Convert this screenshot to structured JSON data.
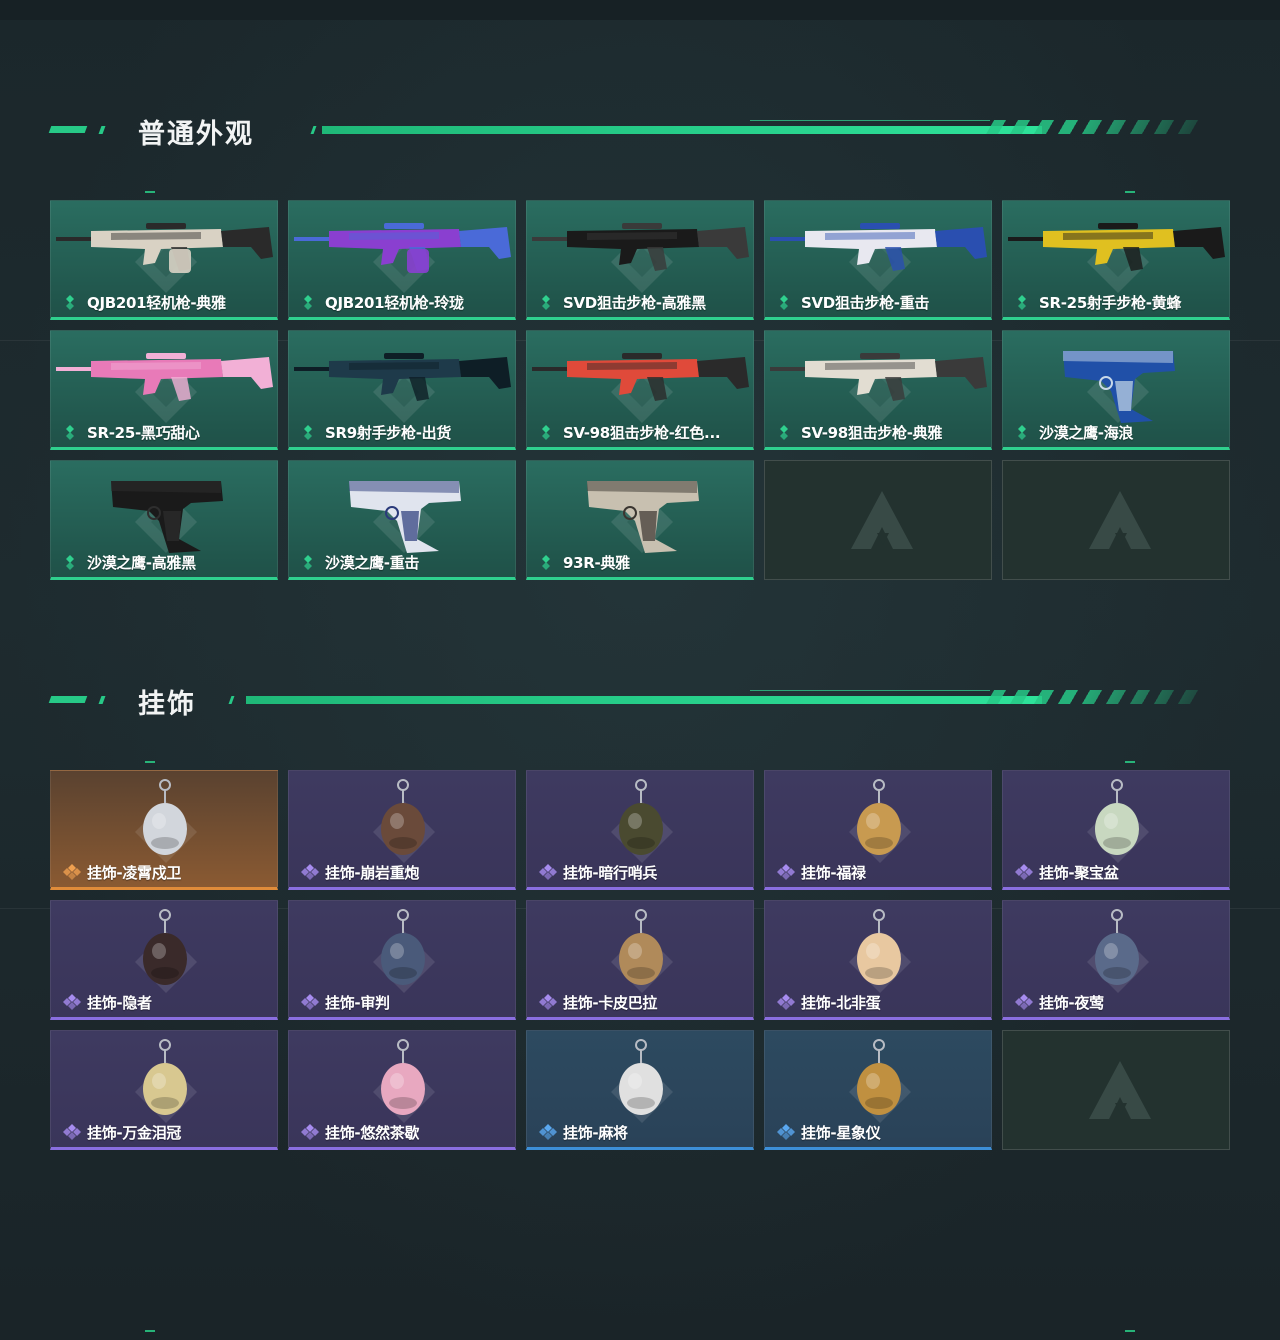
{
  "sections": [
    {
      "title": "普通外观",
      "items": [
        {
          "label": "QJB201轻机枪-典雅",
          "rarity": "green",
          "icon": "light-machine-gun"
        },
        {
          "label": "QJB201轻机枪-玲珑",
          "rarity": "green",
          "icon": "light-machine-gun"
        },
        {
          "label": "SVD狙击步枪-高雅黑",
          "rarity": "green",
          "icon": "sniper-rifle"
        },
        {
          "label": "SVD狙击步枪-重击",
          "rarity": "green",
          "icon": "sniper-rifle"
        },
        {
          "label": "SR-25射手步枪-黄蜂",
          "rarity": "green",
          "icon": "marksman-rifle"
        },
        {
          "label": "SR-25-黑巧甜心",
          "rarity": "green",
          "icon": "marksman-rifle"
        },
        {
          "label": "SR9射手步枪-出货",
          "rarity": "green",
          "icon": "marksman-rifle"
        },
        {
          "label": "SV-98狙击步枪-红色...",
          "rarity": "green",
          "icon": "sniper-rifle"
        },
        {
          "label": "SV-98狙击步枪-典雅",
          "rarity": "green",
          "icon": "sniper-rifle"
        },
        {
          "label": "沙漠之鹰-海浪",
          "rarity": "green",
          "icon": "pistol"
        },
        {
          "label": "沙漠之鹰-高雅黑",
          "rarity": "green",
          "icon": "pistol"
        },
        {
          "label": "沙漠之鹰-重击",
          "rarity": "green",
          "icon": "pistol"
        },
        {
          "label": "93R-典雅",
          "rarity": "green",
          "icon": "pistol"
        },
        {
          "label": "",
          "rarity": "empty",
          "icon": "logo"
        },
        {
          "label": "",
          "rarity": "empty",
          "icon": "logo"
        }
      ]
    },
    {
      "title": "挂饰",
      "items": [
        {
          "label": "挂饰-凌霄戍卫",
          "rarity": "orange",
          "icon": "charm"
        },
        {
          "label": "挂饰-崩岩重炮",
          "rarity": "purple",
          "icon": "charm"
        },
        {
          "label": "挂饰-暗行哨兵",
          "rarity": "purple",
          "icon": "charm"
        },
        {
          "label": "挂饰-福禄",
          "rarity": "purple",
          "icon": "charm"
        },
        {
          "label": "挂饰-聚宝盆",
          "rarity": "purple",
          "icon": "charm"
        },
        {
          "label": "挂饰-隐者",
          "rarity": "purple",
          "icon": "charm"
        },
        {
          "label": "挂饰-审判",
          "rarity": "purple",
          "icon": "charm"
        },
        {
          "label": "挂饰-卡皮巴拉",
          "rarity": "purple",
          "icon": "charm"
        },
        {
          "label": "挂饰-北非蛋",
          "rarity": "purple",
          "icon": "charm"
        },
        {
          "label": "挂饰-夜莺",
          "rarity": "purple",
          "icon": "charm"
        },
        {
          "label": "挂饰-万金泪冠",
          "rarity": "purple",
          "icon": "charm"
        },
        {
          "label": "挂饰-悠然茶歇",
          "rarity": "purple",
          "icon": "charm"
        },
        {
          "label": "挂饰-麻将",
          "rarity": "blue",
          "icon": "charm"
        },
        {
          "label": "挂饰-星象仪",
          "rarity": "blue",
          "icon": "charm"
        },
        {
          "label": "",
          "rarity": "empty",
          "icon": "logo"
        }
      ]
    }
  ],
  "colors": {
    "accent": "#27c987",
    "green_card": "#2a6d60",
    "purple_card": "#3e3a60",
    "orange_card": "#8a5a32",
    "blue_card": "#2d4a60",
    "background": "#1e2b2f"
  }
}
